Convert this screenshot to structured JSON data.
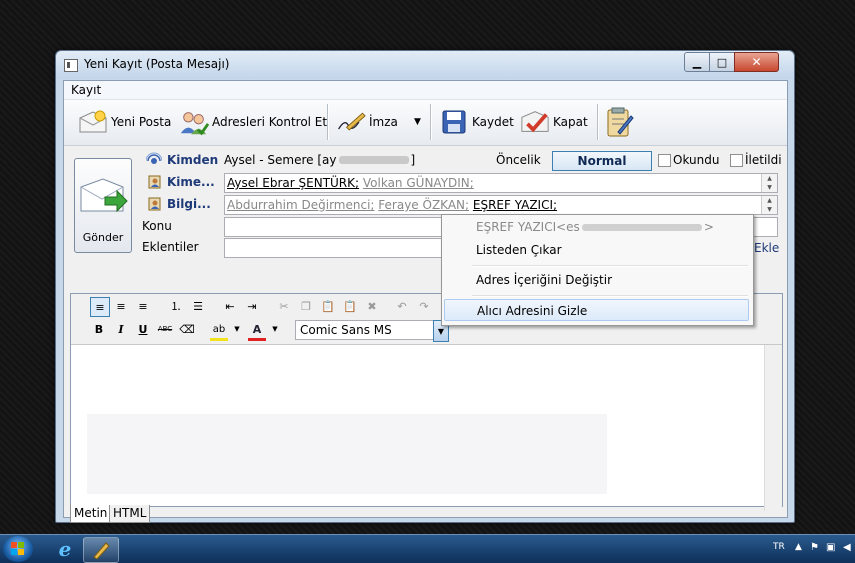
{
  "window": {
    "title": "Yeni Kayıt (Posta Mesajı)"
  },
  "menu": {
    "items": [
      "Kayıt"
    ]
  },
  "toolbar": {
    "new_mail": "Yeni Posta",
    "check_addresses": "Adresleri Kontrol Et",
    "signature": "İmza",
    "save": "Kaydet",
    "close": "Kapat"
  },
  "header": {
    "send_label": "Gönder",
    "from_label": "Kimden",
    "from_value": "Aysel - Semere [ay",
    "from_value_end": "]",
    "to_label": "Kime...",
    "to_recipients": [
      {
        "name": "Aysel Ebrar ŞENTÜRK;",
        "style": "solid"
      },
      {
        "name": "Volkan GÜNAYDIN;",
        "style": "gray"
      }
    ],
    "cc_label": "Bilgi...",
    "cc_recipients": [
      {
        "name": "Abdurrahim Değirmenci;",
        "style": "gray"
      },
      {
        "name": "Feraye ÖZKAN;",
        "style": "gray"
      },
      {
        "name": "EŞREF YAZICI;",
        "style": "solid"
      }
    ],
    "subject_label": "Konu",
    "attachments_label": "Eklentiler",
    "attach_add": "Ekle",
    "priority_label": "Öncelik",
    "priority_value": "Normal",
    "read_label": "Okundu",
    "forwarded_label": "İletildi"
  },
  "editor": {
    "font_name": "Comic Sans MS",
    "tabs": [
      "Metin",
      "HTML"
    ],
    "active_tab": "Metin"
  },
  "context_menu": {
    "header": "EŞREF YAZICI<es",
    "header_end": ">",
    "items": [
      "Listeden Çıkar",
      "Adres İçeriğini Değiştir",
      "Alıcı Adresini Gizle"
    ],
    "hovered": "Alıcı Adresini Gizle"
  },
  "taskbar": {
    "lang": "TR"
  },
  "colors": {
    "accent": "#3c7fb1",
    "highlight": "#dceafa",
    "link": "#1f3a78"
  }
}
